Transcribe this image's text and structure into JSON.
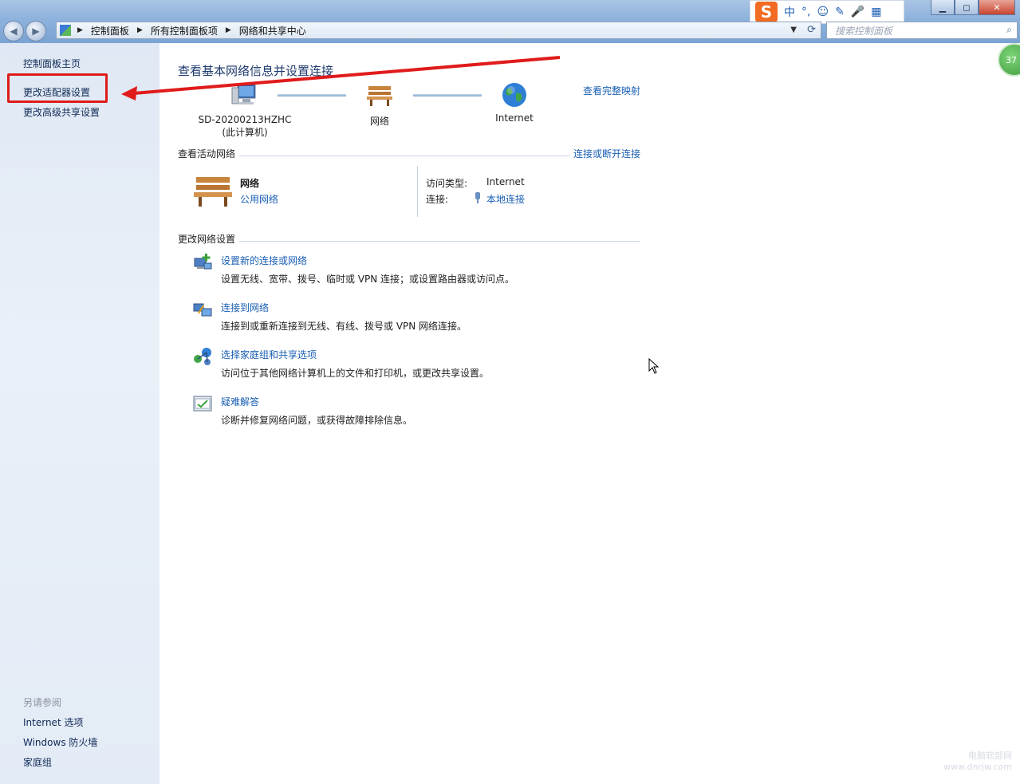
{
  "ime": {
    "logo": "S",
    "items": [
      "中",
      "°,",
      "☺",
      "✎",
      "🎤",
      "▦"
    ]
  },
  "window": {
    "min": "▁",
    "max": "◻",
    "close": "✕"
  },
  "navbar": {
    "breadcrumb": [
      "控制面板",
      "所有控制面板项",
      "网络和共享中心"
    ],
    "search_placeholder": "搜索控制面板"
  },
  "sidebar": {
    "home": "控制面板主页",
    "adapter": "更改适配器设置",
    "advanced": "更改高级共享设置",
    "see_also": "另请参阅",
    "see_also_items": [
      "Internet 选项",
      "Windows 防火墙",
      "家庭组"
    ]
  },
  "main": {
    "title": "查看基本网络信息并设置连接",
    "full_map": "查看完整映射",
    "map": {
      "computer_name": "SD-20200213HZHC",
      "computer_sub": "(此计算机)",
      "network": "网络",
      "internet": "Internet"
    },
    "active_network": {
      "heading": "查看活动网络",
      "connect_link": "连接或断开连接",
      "name": "网络",
      "type": "公用网络",
      "access_label": "访问类型:",
      "access_value": "Internet",
      "conn_label": "连接:",
      "conn_value": "本地连接"
    },
    "change_settings": {
      "heading": "更改网络设置",
      "tasks": [
        {
          "title": "设置新的连接或网络",
          "desc": "设置无线、宽带、拨号、临时或 VPN 连接；或设置路由器或访问点。"
        },
        {
          "title": "连接到网络",
          "desc": "连接到或重新连接到无线、有线、拨号或 VPN 网络连接。"
        },
        {
          "title": "选择家庭组和共享选项",
          "desc": "访问位于其他网络计算机上的文件和打印机，或更改共享设置。"
        },
        {
          "title": "疑难解答",
          "desc": "诊断并修复网络问题，或获得故障排除信息。"
        }
      ]
    }
  },
  "badge": "37",
  "watermark": {
    "line1": "电脑软部网",
    "line2": "www.dnrjw.com"
  },
  "colors": {
    "annotation": "#e01b1b",
    "link": "#1a5fb4",
    "sidebar_bg": "#e3ebf6"
  }
}
